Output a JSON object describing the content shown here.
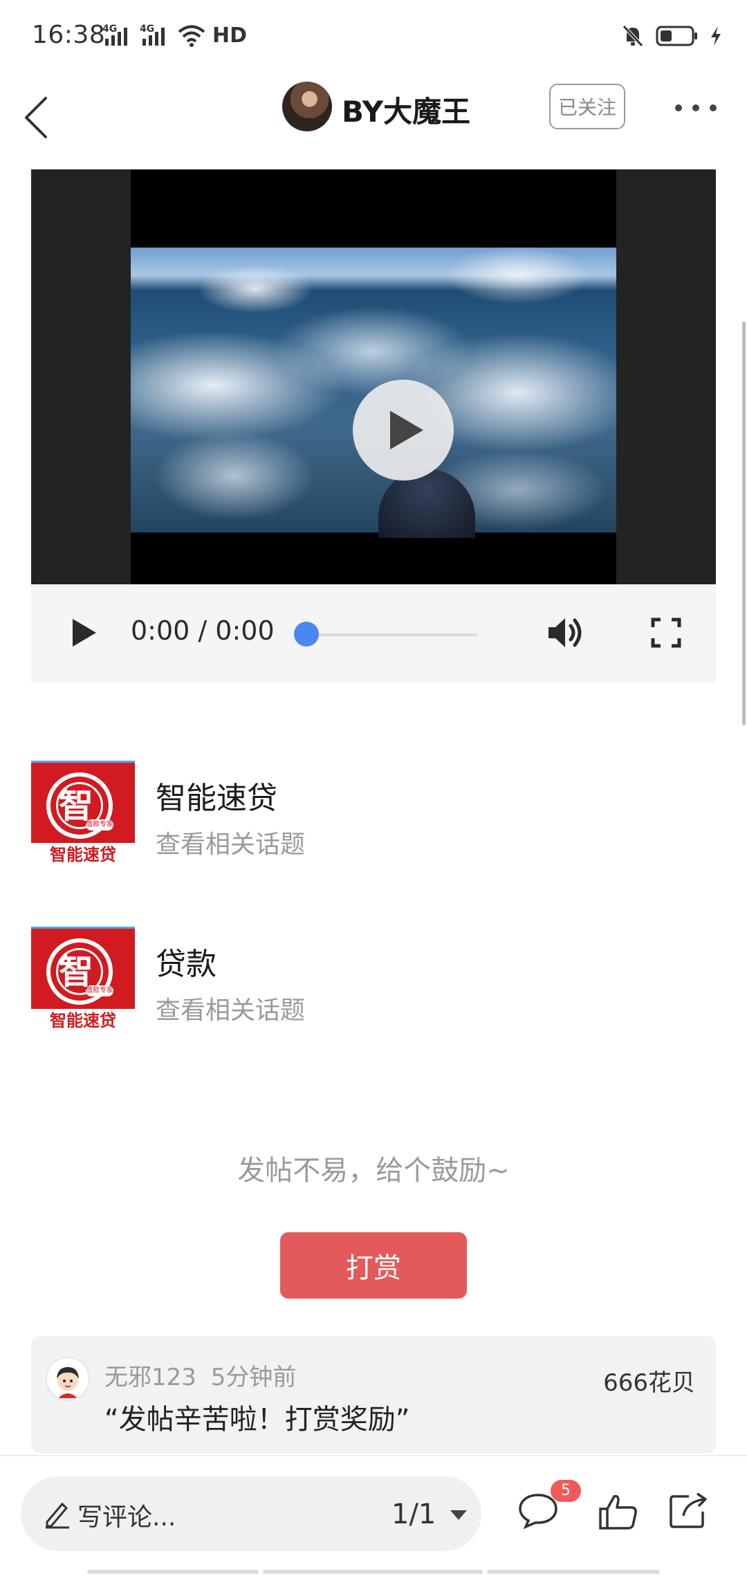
{
  "status_bar": {
    "time": "16:38",
    "network_1": "4G",
    "network_2": "4G",
    "hd": "HD",
    "icons": [
      "signal-icon",
      "signal-icon",
      "wifi-icon",
      "mute-icon",
      "battery-icon",
      "charging-icon"
    ]
  },
  "header": {
    "name": "BY大魔王",
    "follow_label": "已关注",
    "icons": [
      "back-icon",
      "more-icon"
    ]
  },
  "video": {
    "time": "0:00 / 0:00",
    "progress": 0,
    "accent": "#4a87f0",
    "icons": [
      "play-icon",
      "volume-icon",
      "fullscreen-icon"
    ]
  },
  "topics": [
    {
      "title": "智能速贷",
      "subtitle": "查看相关话题",
      "logo_char": "智",
      "logo_caption": "智能速贷",
      "logo_badge": "借款专家"
    },
    {
      "title": "贷款",
      "subtitle": "查看相关话题",
      "logo_char": "智",
      "logo_caption": "智能速贷",
      "logo_badge": "借款专家"
    }
  ],
  "encourage": {
    "text": "发帖不易，给个鼓励~",
    "button": "打赏",
    "button_color": "#e35a5a"
  },
  "reward": {
    "user": "无邪123",
    "time": "5分钟前",
    "message": "“发帖辛苦啦！打赏奖励”",
    "amount": "666花贝"
  },
  "bottom_bar": {
    "comment_placeholder": "写评论...",
    "page_counter": "1/1",
    "comment_badge": "5",
    "badge_color": "#f15a5a",
    "icons": [
      "pencil-icon",
      "dropdown-icon",
      "comment-icon",
      "like-icon",
      "share-icon"
    ]
  }
}
